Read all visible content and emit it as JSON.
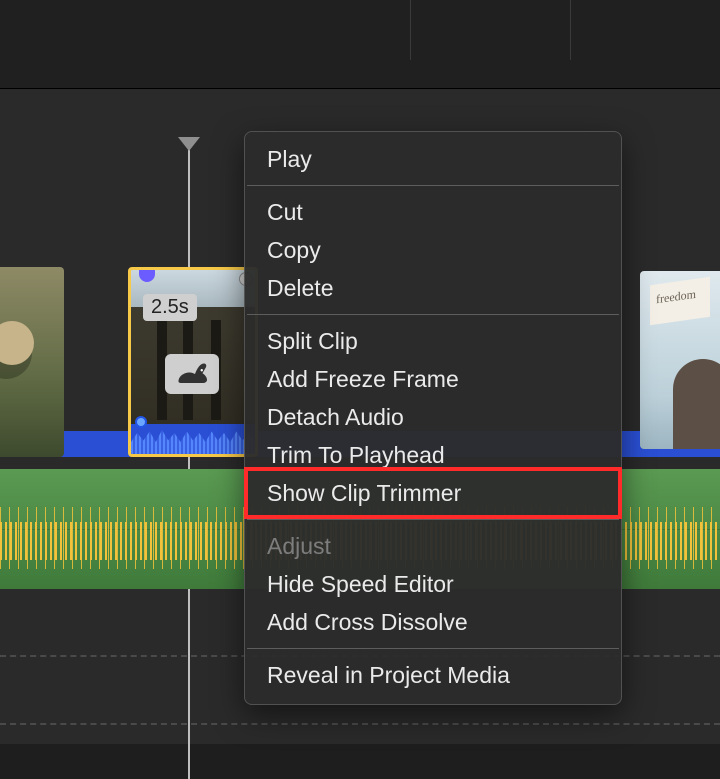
{
  "clip": {
    "duration_label": "2.5s"
  },
  "menu": {
    "play": "Play",
    "cut": "Cut",
    "copy": "Copy",
    "delete": "Delete",
    "split_clip": "Split Clip",
    "add_freeze_frame": "Add Freeze Frame",
    "detach_audio": "Detach Audio",
    "trim_to_playhead": "Trim To Playhead",
    "show_clip_trimmer": "Show Clip Trimmer",
    "adjust": "Adjust",
    "hide_speed_editor": "Hide Speed Editor",
    "add_cross_dissolve": "Add Cross Dissolve",
    "reveal_in_project_media": "Reveal in Project Media"
  },
  "highlighted_menu_item": "show_clip_trimmer"
}
